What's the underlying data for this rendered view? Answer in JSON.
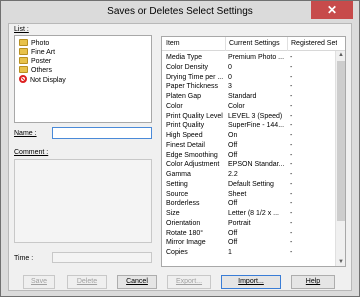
{
  "window": {
    "title": "Saves or Deletes Select Settings",
    "close_glyph": "✕"
  },
  "list": {
    "label": "List :",
    "items": [
      {
        "label": "Photo",
        "icon": "folder-icon"
      },
      {
        "label": "Fine Art",
        "icon": "folder-icon"
      },
      {
        "label": "Poster",
        "icon": "folder-icon"
      },
      {
        "label": "Others",
        "icon": "folder-icon"
      },
      {
        "label": "Not Display",
        "icon": "no-entry-icon"
      }
    ]
  },
  "form": {
    "name_label": "Name :",
    "name_value": "",
    "comment_label": "Comment :",
    "time_label": "Time :"
  },
  "table": {
    "headers": [
      "Item",
      "Current Settings",
      "Registered Sett..."
    ],
    "rows": [
      [
        "Media Type",
        "Premium Photo ...",
        "-"
      ],
      [
        "Color Density",
        "0",
        "-"
      ],
      [
        "Drying Time per ...",
        "0",
        "-"
      ],
      [
        "Paper Thickness",
        "3",
        "-"
      ],
      [
        "Platen Gap",
        "Standard",
        "-"
      ],
      [
        "Color",
        "Color",
        "-"
      ],
      [
        "Print Quality Level",
        "LEVEL 3 (Speed)",
        "-"
      ],
      [
        "Print Quality",
        "SuperFine - 144...",
        "-"
      ],
      [
        "High Speed",
        "On",
        "-"
      ],
      [
        "Finest Detail",
        "Off",
        "-"
      ],
      [
        "Edge Smoothing",
        "Off",
        "-"
      ],
      [
        "Color Adjustment",
        "EPSON Standar...",
        "-"
      ],
      [
        "Gamma",
        "2.2",
        "-"
      ],
      [
        "Setting",
        "Default Setting",
        "-"
      ],
      [
        "Source",
        "Sheet",
        "-"
      ],
      [
        "Borderless",
        "Off",
        "-"
      ],
      [
        "Size",
        "Letter (8 1/2 x ...",
        "-"
      ],
      [
        "Orientation",
        "Portrait",
        "-"
      ],
      [
        "Rotate 180°",
        "Off",
        "-"
      ],
      [
        "Mirror Image",
        "Off",
        "-"
      ],
      [
        "Copies",
        "1",
        "-"
      ]
    ]
  },
  "buttons": {
    "save": "Save",
    "delete": "Delete",
    "cancel": "Cancel",
    "export": "Export...",
    "import": "Import...",
    "help": "Help"
  }
}
